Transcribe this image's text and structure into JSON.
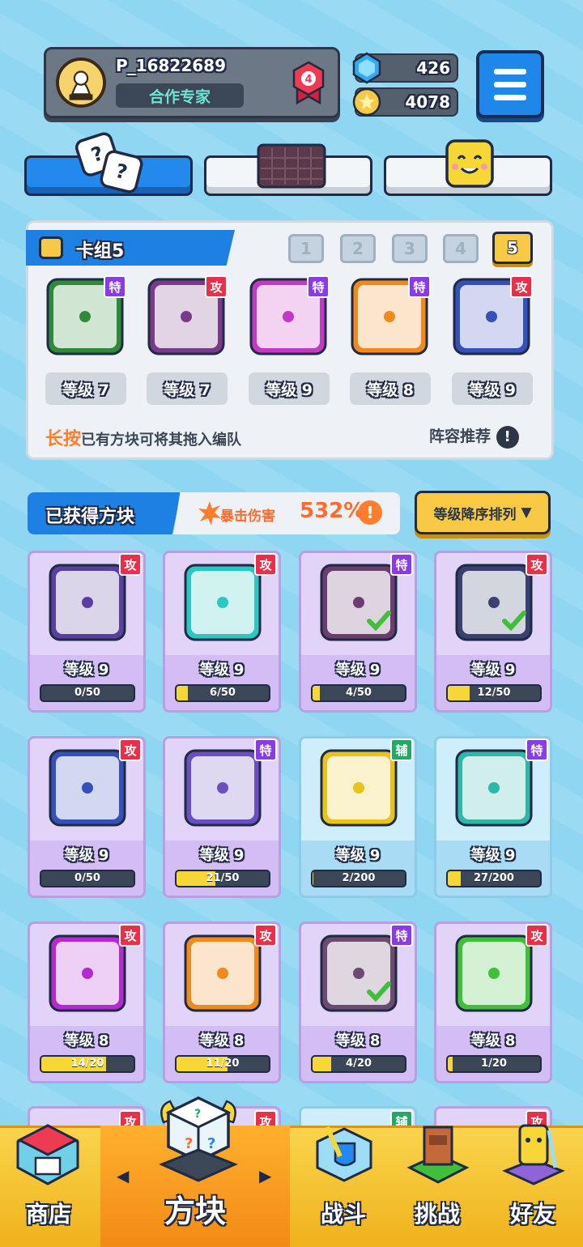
{
  "profile": {
    "name": "P_16822689",
    "title": "合作专家",
    "rank_level": "4"
  },
  "currency": {
    "gems": "426",
    "coins": "4078"
  },
  "deck": {
    "title": "卡组5",
    "slots": [
      "1",
      "2",
      "3",
      "4",
      "5"
    ],
    "active_slot": "5",
    "cards": [
      {
        "badge": "特",
        "badge_type": "spe",
        "level": "等级 7",
        "theme": "green-dragon"
      },
      {
        "badge": "攻",
        "badge_type": "atk",
        "level": "等级 7",
        "theme": "red-dragon"
      },
      {
        "badge": "特",
        "badge_type": "spe",
        "level": "等级 9",
        "theme": "magenta-arrow"
      },
      {
        "badge": "特",
        "badge_type": "spe",
        "level": "等级 8",
        "theme": "rainbow"
      },
      {
        "badge": "攻",
        "badge_type": "atk",
        "level": "等级 9",
        "theme": "blue-gear"
      }
    ],
    "hint_em": "长按",
    "hint_rest": "已有方块可将其拖入编队",
    "recommend": "阵容推荐"
  },
  "owned": {
    "title": "已获得方块",
    "crit_label": "暴击伤害",
    "crit_value": "532%",
    "sort_label": "等级降序排列"
  },
  "cards": [
    {
      "badge": "攻",
      "badge_type": "atk",
      "level": "等级 9",
      "progress": "0/50",
      "fill": 0.0,
      "color": "#5b3fa0",
      "bg": "purple",
      "check": false
    },
    {
      "badge": "攻",
      "badge_type": "atk",
      "level": "等级 9",
      "progress": "6/50",
      "fill": 0.12,
      "color": "#2cc7c2",
      "bg": "purple",
      "check": false
    },
    {
      "badge": "特",
      "badge_type": "spe",
      "level": "等级 9",
      "progress": "4/50",
      "fill": 0.08,
      "color": "#6b3d6f",
      "bg": "purple",
      "check": true
    },
    {
      "badge": "攻",
      "badge_type": "atk",
      "level": "等级 9",
      "progress": "12/50",
      "fill": 0.24,
      "color": "#3a4070",
      "bg": "purple",
      "check": true
    },
    {
      "badge": "攻",
      "badge_type": "atk",
      "level": "等级 9",
      "progress": "0/50",
      "fill": 0.0,
      "color": "#3550b8",
      "bg": "purple",
      "check": false
    },
    {
      "badge": "特",
      "badge_type": "spe",
      "level": "等级 9",
      "progress": "21/50",
      "fill": 0.42,
      "color": "#6a4fc0",
      "bg": "purple",
      "check": false
    },
    {
      "badge": "辅",
      "badge_type": "sup",
      "level": "等级 9",
      "progress": "2/200",
      "fill": 0.01,
      "color": "#e8c31a",
      "bg": "blue",
      "check": false
    },
    {
      "badge": "特",
      "badge_type": "spe",
      "level": "等级 9",
      "progress": "27/200",
      "fill": 0.135,
      "color": "#2cb7a8",
      "bg": "blue",
      "check": false
    },
    {
      "badge": "攻",
      "badge_type": "atk",
      "level": "等级 8",
      "progress": "14/20",
      "fill": 0.7,
      "color": "#b52ad0",
      "bg": "purple",
      "check": false
    },
    {
      "badge": "攻",
      "badge_type": "atk",
      "level": "等级 8",
      "progress": "11/20",
      "fill": 0.55,
      "color": "#f08a1c",
      "bg": "purple",
      "check": false
    },
    {
      "badge": "特",
      "badge_type": "spe",
      "level": "等级 8",
      "progress": "4/20",
      "fill": 0.2,
      "color": "#6b4b6f",
      "bg": "purple",
      "check": true
    },
    {
      "badge": "攻",
      "badge_type": "atk",
      "level": "等级 8",
      "progress": "1/20",
      "fill": 0.05,
      "color": "#3fbf3a",
      "bg": "purple",
      "check": false
    }
  ],
  "peek_badges": [
    {
      "badge": "攻",
      "badge_type": "atk"
    },
    {
      "badge": "攻",
      "badge_type": "atk"
    },
    {
      "badge": "辅",
      "badge_type": "sup"
    },
    {
      "badge": "攻",
      "badge_type": "atk"
    }
  ],
  "nav": {
    "shop": "商店",
    "blocks": "方块",
    "battle": "战斗",
    "challenge": "挑战",
    "friends": "好友"
  }
}
